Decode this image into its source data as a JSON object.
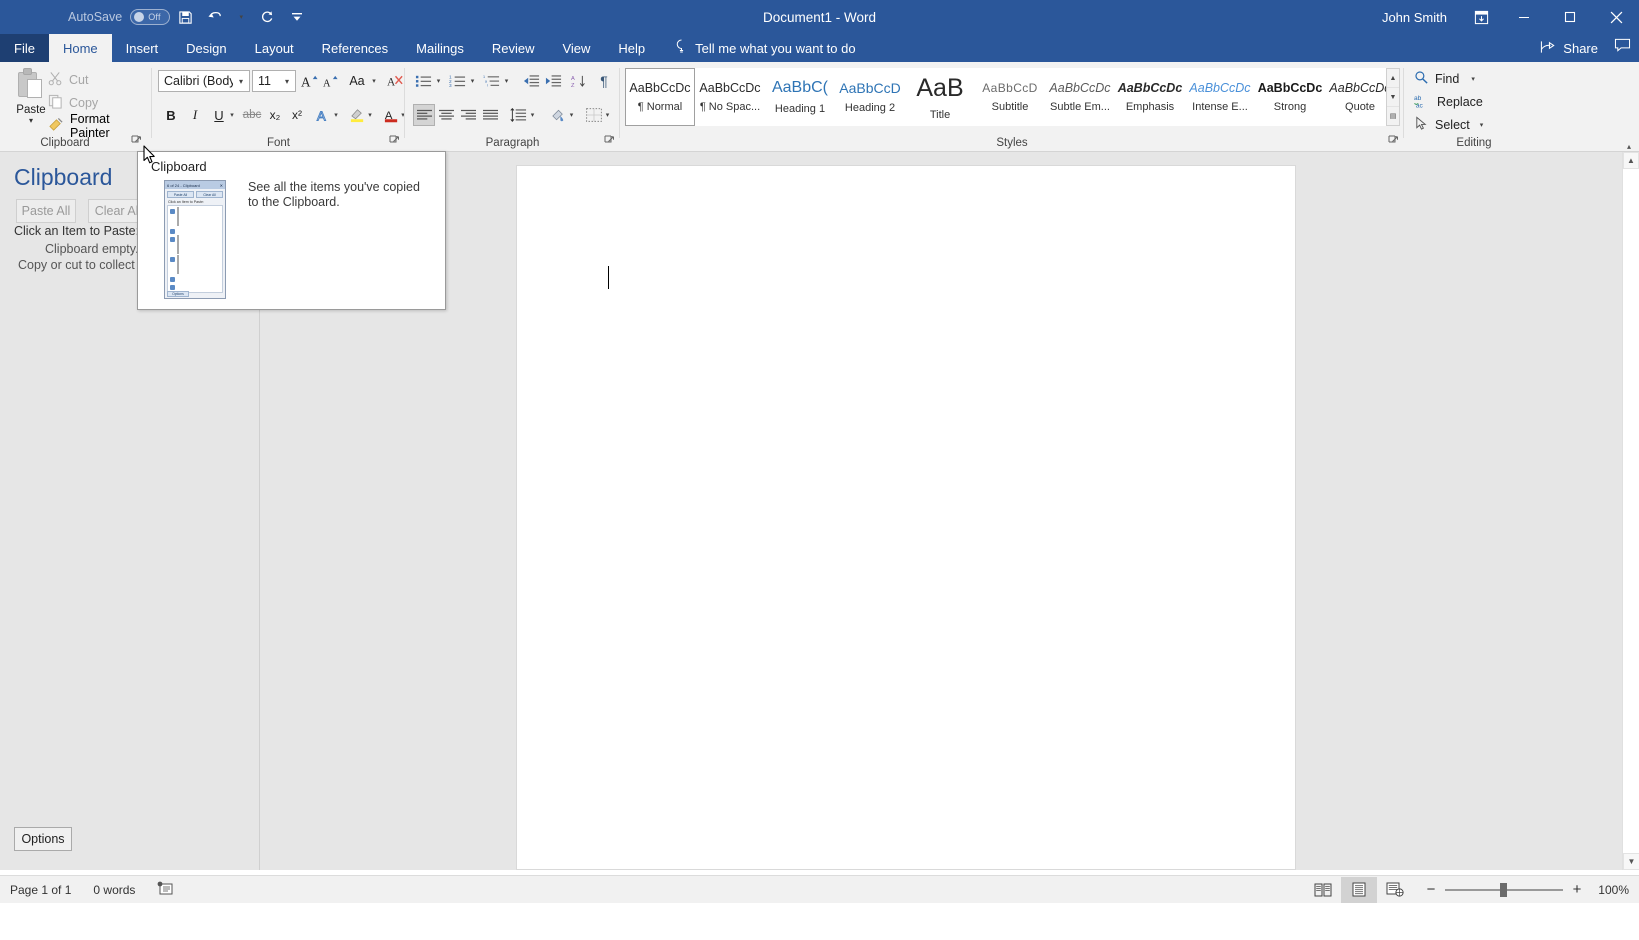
{
  "titlebar": {
    "autosave_label": "AutoSave",
    "autosave_state": "Off",
    "save_icon": "save-icon",
    "undo_icon": "undo-icon",
    "redo_icon": "redo-icon",
    "customize_qat_icon": "customize-quick-access-toolbar-icon",
    "document_title": "Document1  -  Word",
    "user_name": "John Smith",
    "ribbon_display_icon": "ribbon-display-options-icon",
    "minimize_icon": "minimize-icon",
    "restore_icon": "restore-icon",
    "close_icon": "close-icon",
    "brand_color": "#2b579a"
  },
  "tabs": [
    {
      "label": "File",
      "id": "file"
    },
    {
      "label": "Home",
      "id": "home",
      "active": true
    },
    {
      "label": "Insert",
      "id": "insert"
    },
    {
      "label": "Design",
      "id": "design"
    },
    {
      "label": "Layout",
      "id": "layout"
    },
    {
      "label": "References",
      "id": "references"
    },
    {
      "label": "Mailings",
      "id": "mailings"
    },
    {
      "label": "Review",
      "id": "review"
    },
    {
      "label": "View",
      "id": "view"
    },
    {
      "label": "Help",
      "id": "help"
    }
  ],
  "tellme": {
    "icon": "lightbulb-icon",
    "text": "Tell me what you want to do"
  },
  "share": {
    "label": "Share",
    "icon": "share-icon",
    "comments_icon": "comments-icon"
  },
  "ribbon": {
    "groups": [
      {
        "id": "clipboard",
        "label": "Clipboard",
        "launcher": true
      },
      {
        "id": "font",
        "label": "Font",
        "launcher": true
      },
      {
        "id": "paragraph",
        "label": "Paragraph",
        "launcher": true
      },
      {
        "id": "styles",
        "label": "Styles",
        "launcher": true
      },
      {
        "id": "editing",
        "label": "Editing",
        "launcher": false
      }
    ],
    "clipboard": {
      "paste_label": "Paste",
      "cut_label": "Cut",
      "copy_label": "Copy",
      "format_painter_label": "Format Painter",
      "cut_icon": "scissors-icon",
      "copy_icon": "copy-icon",
      "format_painter_icon": "paintbrush-icon",
      "paste_icon": "clipboard-icon"
    },
    "font": {
      "font_name": "Calibri (Body)",
      "font_size": "11",
      "grow_font_icon": "grow-font-icon",
      "shrink_font_icon": "shrink-font-icon",
      "change_case_label": "Aa",
      "clear_formatting_icon": "clear-formatting-icon",
      "bold": "B",
      "italic": "I",
      "underline": "U",
      "strikethrough": "abc",
      "subscript": "x₂",
      "superscript": "x²",
      "text_effects_icon": "text-effects-icon",
      "highlight_icon": "text-highlight-color-icon",
      "font_color_icon": "font-color-icon"
    },
    "paragraph": {
      "bullets_icon": "bullets-icon",
      "numbering_icon": "numbering-icon",
      "multilevel_icon": "multilevel-list-icon",
      "decrease_indent_icon": "decrease-indent-icon",
      "increase_indent_icon": "increase-indent-icon",
      "sort_icon": "sort-icon",
      "show_marks_icon": "show-formatting-marks-icon",
      "align_left_icon": "align-left-icon",
      "align_center_icon": "align-center-icon",
      "align_right_icon": "align-right-icon",
      "justify_icon": "justify-icon",
      "line_spacing_icon": "line-spacing-icon",
      "shading_icon": "shading-icon",
      "borders_icon": "borders-icon"
    },
    "styles": {
      "items": [
        {
          "preview": "AaBbCcDc",
          "name": "¶ Normal",
          "selected": true
        },
        {
          "preview": "AaBbCcDc",
          "name": "¶ No Spac..."
        },
        {
          "preview": "AaBbC(",
          "name": "Heading 1"
        },
        {
          "preview": "AaBbCcD",
          "name": "Heading 2"
        },
        {
          "preview": "AaB",
          "name": "Title"
        },
        {
          "preview": "AaBbCcD",
          "name": "Subtitle"
        },
        {
          "preview": "AaBbCcDc",
          "name": "Subtle Em..."
        },
        {
          "preview": "AaBbCcDc",
          "name": "Emphasis"
        },
        {
          "preview": "AaBbCcDc",
          "name": "Intense E..."
        },
        {
          "preview": "AaBbCcDc",
          "name": "Strong"
        },
        {
          "preview": "AaBbCcDc",
          "name": "Quote"
        }
      ],
      "scroll_up_icon": "scroll-up-icon",
      "scroll_down_icon": "scroll-down-icon",
      "more_icon": "more-styles-icon"
    },
    "editing": {
      "find_label": "Find",
      "replace_label": "Replace",
      "select_label": "Select",
      "find_icon": "magnifier-icon",
      "replace_icon": "replace-icon",
      "select_icon": "select-arrow-icon"
    }
  },
  "clipboard_pane": {
    "title": "Clipboard",
    "paste_all_label": "Paste All",
    "clear_all_label": "Clear All",
    "hint_label": "Click an Item to Paste:",
    "empty_label": "Clipboard empty.",
    "empty_sub_label": "Copy or cut to collect ite",
    "options_label": "Options"
  },
  "tooltip": {
    "title": "Clipboard",
    "body": "See all the items you've copied to the Clipboard.",
    "thumb": {
      "titlebar": "6 of 24 - Clipboard",
      "paste_all": "Paste All",
      "clear_all": "Clear All",
      "hint": "Click an Item to Paste:",
      "options": "Options",
      "items": [
        {
          "kind": "image",
          "tone": "a"
        },
        {
          "kind": "text",
          "lines": 3
        },
        {
          "kind": "image",
          "tone": "b"
        },
        {
          "kind": "image",
          "tone": "c"
        },
        {
          "kind": "text",
          "lines": 3
        },
        {
          "kind": "text",
          "lines": 3
        }
      ]
    }
  },
  "document": {
    "caret": "text-cursor"
  },
  "statusbar": {
    "page_label": "Page 1 of 1",
    "word_count": "0 words",
    "proofing_icon": "proofing-errors-icon",
    "read_mode_icon": "read-mode-icon",
    "print_layout_icon": "print-layout-icon",
    "web_layout_icon": "web-layout-icon",
    "zoom_out_label": "−",
    "zoom_in_label": "+",
    "zoom_level": "100%"
  }
}
